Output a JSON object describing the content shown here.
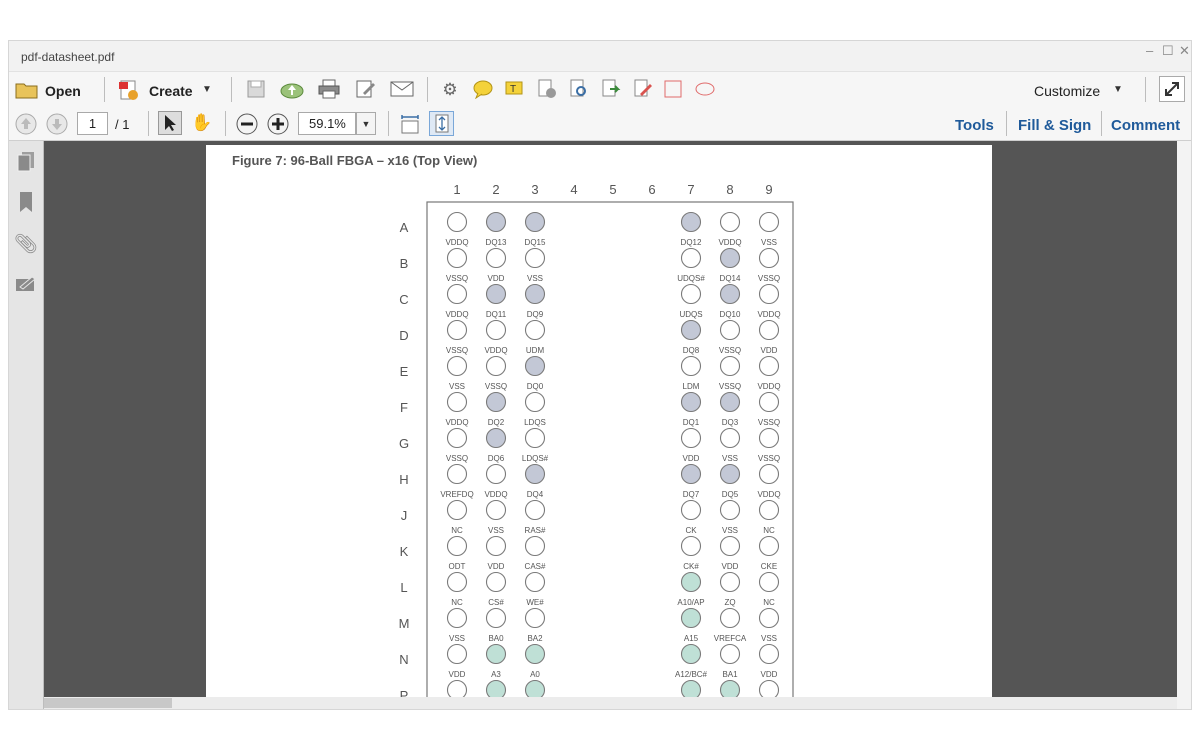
{
  "window": {
    "title": "pdf-datasheet.pdf"
  },
  "toolbar": {
    "open_label": "Open",
    "create_label": "Create",
    "customize_label": "Customize"
  },
  "nav": {
    "page_value": "1",
    "page_total": "/ 1",
    "zoom_value": "59.1%"
  },
  "panels": {
    "tools": "Tools",
    "fill_sign": "Fill & Sign",
    "comment": "Comment"
  },
  "document": {
    "figure_title": "Figure 7: 96-Ball FBGA – x16 (Top View)",
    "columns": [
      "1",
      "2",
      "3",
      "4",
      "5",
      "6",
      "7",
      "8",
      "9"
    ],
    "rows": [
      {
        "row": "A",
        "left": [
          "VDDQ",
          "DQ13",
          "DQ15"
        ],
        "right": [
          "DQ12",
          "VDDQ",
          "VSS"
        ]
      },
      {
        "row": "B",
        "left": [
          "VSSQ",
          "VDD",
          "VSS"
        ],
        "right": [
          "UDQS#",
          "DQ14",
          "VSSQ"
        ]
      },
      {
        "row": "C",
        "left": [
          "VDDQ",
          "DQ11",
          "DQ9"
        ],
        "right": [
          "UDQS",
          "DQ10",
          "VDDQ"
        ]
      },
      {
        "row": "D",
        "left": [
          "VSSQ",
          "VDDQ",
          "UDM"
        ],
        "right": [
          "DQ8",
          "VSSQ",
          "VDD"
        ]
      },
      {
        "row": "E",
        "left": [
          "VSS",
          "VSSQ",
          "DQ0"
        ],
        "right": [
          "LDM",
          "VSSQ",
          "VDDQ"
        ]
      },
      {
        "row": "F",
        "left": [
          "VDDQ",
          "DQ2",
          "LDQS"
        ],
        "right": [
          "DQ1",
          "DQ3",
          "VSSQ"
        ]
      },
      {
        "row": "G",
        "left": [
          "VSSQ",
          "DQ6",
          "LDQS#"
        ],
        "right": [
          "VDD",
          "VSS",
          "VSSQ"
        ]
      },
      {
        "row": "H",
        "left": [
          "VREFDQ",
          "VDDQ",
          "DQ4"
        ],
        "right": [
          "DQ7",
          "DQ5",
          "VDDQ"
        ]
      },
      {
        "row": "J",
        "left": [
          "NC",
          "VSS",
          "RAS#"
        ],
        "right": [
          "CK",
          "VSS",
          "NC"
        ]
      },
      {
        "row": "K",
        "left": [
          "ODT",
          "VDD",
          "CAS#"
        ],
        "right": [
          "CK#",
          "VDD",
          "CKE"
        ]
      },
      {
        "row": "L",
        "left": [
          "NC",
          "CS#",
          "WE#"
        ],
        "right": [
          "A10/AP",
          "ZQ",
          "NC"
        ]
      },
      {
        "row": "M",
        "left": [
          "VSS",
          "BA0",
          "BA2"
        ],
        "right": [
          "A15",
          "VREFCA",
          "VSS"
        ]
      },
      {
        "row": "N",
        "left": [
          "VDD",
          "A3",
          "A0"
        ],
        "right": [
          "A12/BC#",
          "BA1",
          "VDD"
        ]
      },
      {
        "row": "P",
        "left": [
          "",
          "",
          ""
        ],
        "right": [
          "",
          "",
          ""
        ]
      }
    ],
    "fills": {
      "A": [
        "n",
        "g",
        "g",
        "g",
        "n",
        "n"
      ],
      "B": [
        "n",
        "n",
        "n",
        "n",
        "g",
        "n"
      ],
      "C": [
        "n",
        "g",
        "g",
        "n",
        "g",
        "n"
      ],
      "D": [
        "n",
        "n",
        "n",
        "g",
        "n",
        "n"
      ],
      "E": [
        "n",
        "n",
        "g",
        "n",
        "n",
        "n"
      ],
      "F": [
        "n",
        "g",
        "n",
        "g",
        "g",
        "n"
      ],
      "G": [
        "n",
        "g",
        "n",
        "n",
        "n",
        "n"
      ],
      "H": [
        "n",
        "n",
        "g",
        "g",
        "g",
        "n"
      ],
      "J": [
        "n",
        "n",
        "n",
        "n",
        "n",
        "n"
      ],
      "K": [
        "n",
        "n",
        "n",
        "n",
        "n",
        "n"
      ],
      "L": [
        "n",
        "n",
        "n",
        "t",
        "n",
        "n"
      ],
      "M": [
        "n",
        "n",
        "n",
        "t",
        "n",
        "n"
      ],
      "N": [
        "n",
        "t",
        "t",
        "t",
        "n",
        "n"
      ],
      "P": [
        "n",
        "t",
        "t",
        "t",
        "t",
        "n"
      ]
    },
    "colors": {
      "gray_ball": "#c3c8d6",
      "teal_ball": "#bfe0d6",
      "empty_ball": "#ffffff"
    }
  }
}
